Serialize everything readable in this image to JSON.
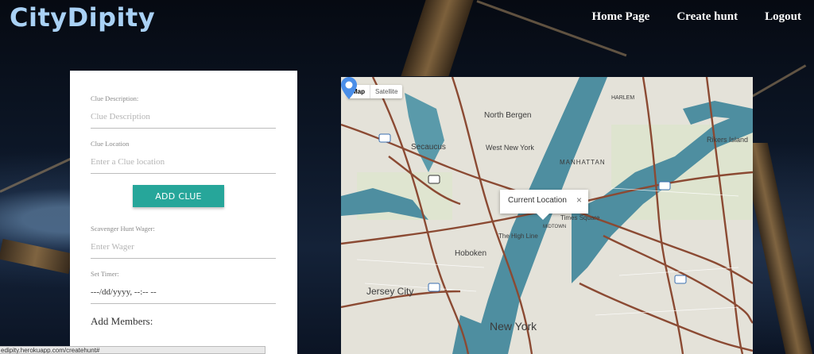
{
  "app": {
    "logo": "CityDipity"
  },
  "nav": {
    "home": "Home Page",
    "create": "Create hunt",
    "logout": "Logout"
  },
  "form": {
    "clue_description_label": "Clue Description:",
    "clue_description_placeholder": "Clue Description",
    "clue_location_label": "Clue Location",
    "clue_location_placeholder": "Enter a Clue location",
    "add_clue_label": "ADD CLUE",
    "wager_label": "Scavenger Hunt Wager:",
    "wager_placeholder": "Enter Wager",
    "timer_label": "Set Timer:",
    "timer_value": "---/dd/yyyy, --:-- --",
    "members_label": "Add Members:"
  },
  "map": {
    "type_map": "Map",
    "type_satellite": "Satellite",
    "info_text": "Current Location",
    "info_close": "×",
    "labels": {
      "north_bergen": "North Bergen",
      "secaucus": "Secaucus",
      "west_new_york": "West New York",
      "manhattan": "MANHATTAN",
      "rikers": "Rikers Island",
      "times_square": "Times Square",
      "high_line": "The High Line",
      "hoboken": "Hoboken",
      "jersey_city": "Jersey City",
      "new_york": "New York",
      "harlem": "HARLEM",
      "midtown": "MIDTOWN"
    },
    "water_color": "#4e8ea0",
    "road_color": "#8b4a33",
    "pin_color": "#4a8ee8"
  },
  "status": {
    "url": "edipity.herokuapp.com/createhunt#"
  }
}
